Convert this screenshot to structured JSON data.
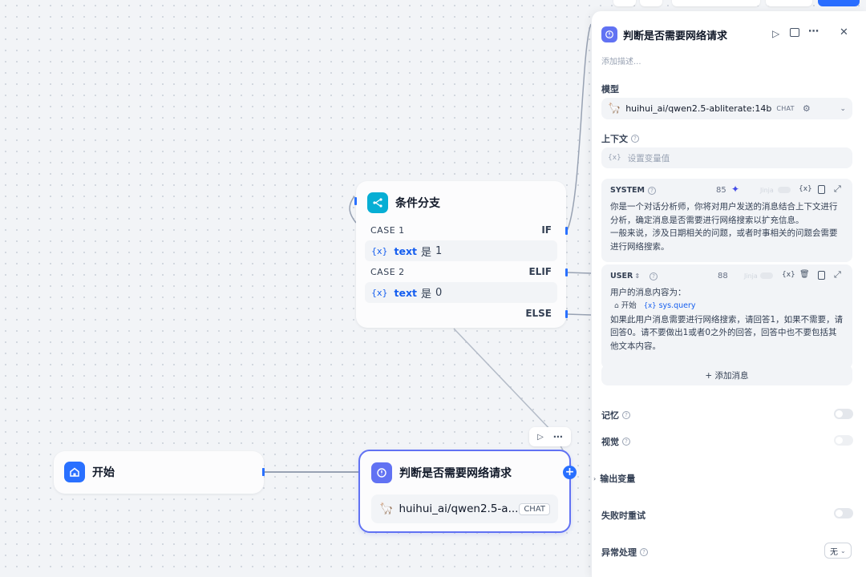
{
  "start_node": {
    "title": "开始"
  },
  "branch_node": {
    "title": "条件分支",
    "cases": [
      {
        "label": "CASE 1",
        "key": "IF",
        "var": "text",
        "op": "是",
        "value": "1"
      },
      {
        "label": "CASE 2",
        "key": "ELIF",
        "var": "text",
        "op": "是",
        "value": "0"
      }
    ],
    "else_label": "ELSE"
  },
  "llm_node": {
    "title": "判断是否需要网络请求",
    "model": "huihui_ai/qwen2.5-a...",
    "badge": "CHAT"
  },
  "panel": {
    "title": "判断是否需要网络请求",
    "desc_placeholder": "添加描述...",
    "model_label": "模型",
    "model_name": "huihui_ai/qwen2.5-abliterate:14b",
    "model_badge": "CHAT",
    "context_label": "上下文",
    "context_placeholder": "设置变量值",
    "var_token": "{x}",
    "system": {
      "role": "SYSTEM",
      "count": "85",
      "jinja": "Jinja",
      "lines": [
        "你是一个对话分析师，你将对用户发送的消息结合上下文进行",
        "分析，确定消息是否需要进行网络搜索以扩充信息。",
        "一般来说，涉及日期相关的问题，或者时事相关的问题会需要",
        "进行网络搜索。"
      ]
    },
    "user": {
      "role": "USER",
      "count": "88",
      "jinja": "Jinja",
      "line1": "用户的消息内容为：",
      "ref_node": "开始",
      "ref_var": "sys.query",
      "lines": [
        "如果此用户消息需要进行网络搜索，请回答1，如果不需要，请",
        "回答0。请不要做出1或者0之外的回答，回答中也不要包括其",
        "他文本内容。"
      ]
    },
    "add_message": "+ 添加消息",
    "memory_label": "记忆",
    "vision_label": "视觉",
    "output_label": "输出变量",
    "retry_label": "失败时重试",
    "error_label": "异常处理",
    "error_value": "无"
  },
  "colors": {
    "accent": "#155eef",
    "start_icon": "#2970ff",
    "branch_icon": "#06aed4",
    "llm_icon": "#6172f3"
  }
}
